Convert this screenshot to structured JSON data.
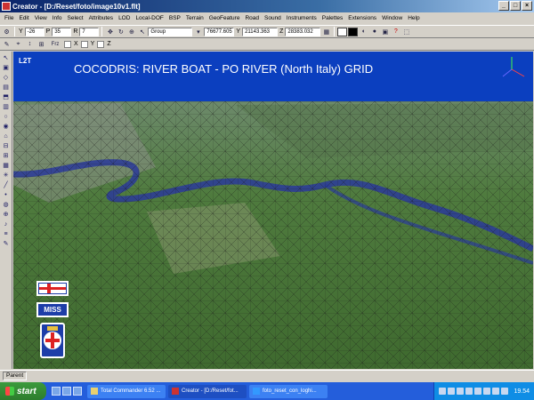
{
  "window": {
    "title": "Creator - [D:/Reset/foto/image10v1.flt]"
  },
  "menu": [
    "File",
    "Edit",
    "View",
    "Info",
    "Select",
    "Attributes",
    "LOD",
    "Local-DOF",
    "BSP",
    "Terrain",
    "GeoFeature",
    "Road",
    "Sound",
    "Instruments",
    "Palettes",
    "Extensions",
    "Window",
    "Help"
  ],
  "toolbar1": {
    "y_label": "Y",
    "y_value": "-26",
    "p_label": "P",
    "p_value": "35",
    "r_label": "R",
    "r_value": "7",
    "group_value": "Group",
    "x_coord": "76677.605",
    "y_coord_label": "Y",
    "y_coord": "21143.363",
    "z_coord_label": "Z",
    "z_coord": "28383.032"
  },
  "toolbar2": {
    "x": "X",
    "y": "Y",
    "z": "Z",
    "frz": "Frz"
  },
  "viewport": {
    "title": "COCODRIS: RIVER BOAT - PO RIVER (North Italy) GRID",
    "tag": "L2T",
    "logo_miss": "MISS"
  },
  "status": {
    "left": "Parent"
  },
  "taskbar": {
    "start": "start",
    "tasks": [
      "Total Commander 6.52 ...",
      "Creator - [D:/Reset/fot...",
      "foto_reset_con_loghi..."
    ],
    "clock": "19.54"
  },
  "colors": {
    "sky": "#0b3fbf",
    "accent": "#0a246a",
    "taskbar": "#245edb"
  }
}
